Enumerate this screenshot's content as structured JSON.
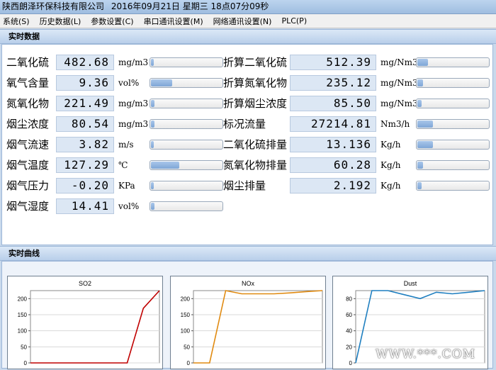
{
  "window": {
    "company": "陕西朗泽环保科技有限公司",
    "datetime": "2016年09月21日 星期三 18点07分09秒"
  },
  "menu": [
    "系统(S)",
    "历史数据(L)",
    "参数设置(C)",
    "串口通讯设置(M)",
    "网络通讯设置(N)",
    "PLC(P)"
  ],
  "realtime": {
    "header": "实时数据",
    "left": [
      {
        "label": "二氧化硫",
        "value": "482.68",
        "unit": "mg/m3",
        "level": 0.03
      },
      {
        "label": "氧气含量",
        "value": "9.36",
        "unit": "vol%",
        "level": 0.3
      },
      {
        "label": "氮氧化物",
        "value": "221.49",
        "unit": "mg/m3",
        "level": 0.05
      },
      {
        "label": "烟尘浓度",
        "value": "80.54",
        "unit": "mg/m3",
        "level": 0.05
      },
      {
        "label": "烟气流速",
        "value": "3.82",
        "unit": "m/s",
        "level": 0.03
      },
      {
        "label": "烟气温度",
        "value": "127.29",
        "unit": "℃",
        "level": 0.4
      },
      {
        "label": "烟气压力",
        "value": "-0.20",
        "unit": "KPa",
        "level": 0.03
      },
      {
        "label": "烟气湿度",
        "value": "14.41",
        "unit": "vol%",
        "level": 0.05
      }
    ],
    "right": [
      {
        "label": "折算二氧化硫",
        "value": "512.39",
        "unit": "mg/Nm3",
        "level": 0.15
      },
      {
        "label": "折算氮氧化物",
        "value": "235.12",
        "unit": "mg/Nm3",
        "level": 0.08
      },
      {
        "label": "折算烟尘浓度",
        "value": "85.50",
        "unit": "mg/Nm3",
        "level": 0.06
      },
      {
        "label": "标况流量",
        "value": "27214.81",
        "unit": "Nm3/h",
        "level": 0.22
      },
      {
        "label": "二氧化硫排量",
        "value": "13.136",
        "unit": "Kg/h",
        "level": 0.22
      },
      {
        "label": "氮氧化物排量",
        "value": "60.28",
        "unit": "Kg/h",
        "level": 0.08
      },
      {
        "label": "烟尘排量",
        "value": "2.192",
        "unit": "Kg/h",
        "level": 0.06
      }
    ]
  },
  "curves": {
    "header": "实时曲线",
    "watermark": "WWW.***.COM"
  },
  "chart_data": [
    {
      "type": "line",
      "title": "SO2",
      "ylim": [
        0,
        225
      ],
      "yticks": [
        0,
        50,
        100,
        150,
        200
      ],
      "color": "#c00000",
      "grid": true,
      "series": [
        {
          "x": [
            0,
            1,
            2,
            3,
            4,
            5,
            6,
            7,
            8
          ],
          "y": [
            0,
            0,
            0,
            0,
            0,
            0,
            0,
            170,
            225
          ]
        }
      ]
    },
    {
      "type": "line",
      "title": "NOx",
      "ylim": [
        0,
        225
      ],
      "yticks": [
        0,
        50,
        100,
        150,
        200
      ],
      "color": "#e08a10",
      "grid": true,
      "series": [
        {
          "x": [
            0,
            1,
            2,
            3,
            4,
            5,
            6,
            7,
            8
          ],
          "y": [
            0,
            0,
            225,
            215,
            215,
            215,
            218,
            222,
            225
          ]
        }
      ]
    },
    {
      "type": "line",
      "title": "Dust",
      "ylim": [
        0,
        90
      ],
      "yticks": [
        0,
        20,
        40,
        60,
        80
      ],
      "color": "#1f7fc0",
      "grid": true,
      "series": [
        {
          "x": [
            0,
            1,
            2,
            3,
            4,
            5,
            6,
            7,
            8
          ],
          "y": [
            0,
            95,
            90,
            85,
            80,
            88,
            86,
            88,
            90
          ]
        }
      ]
    }
  ]
}
